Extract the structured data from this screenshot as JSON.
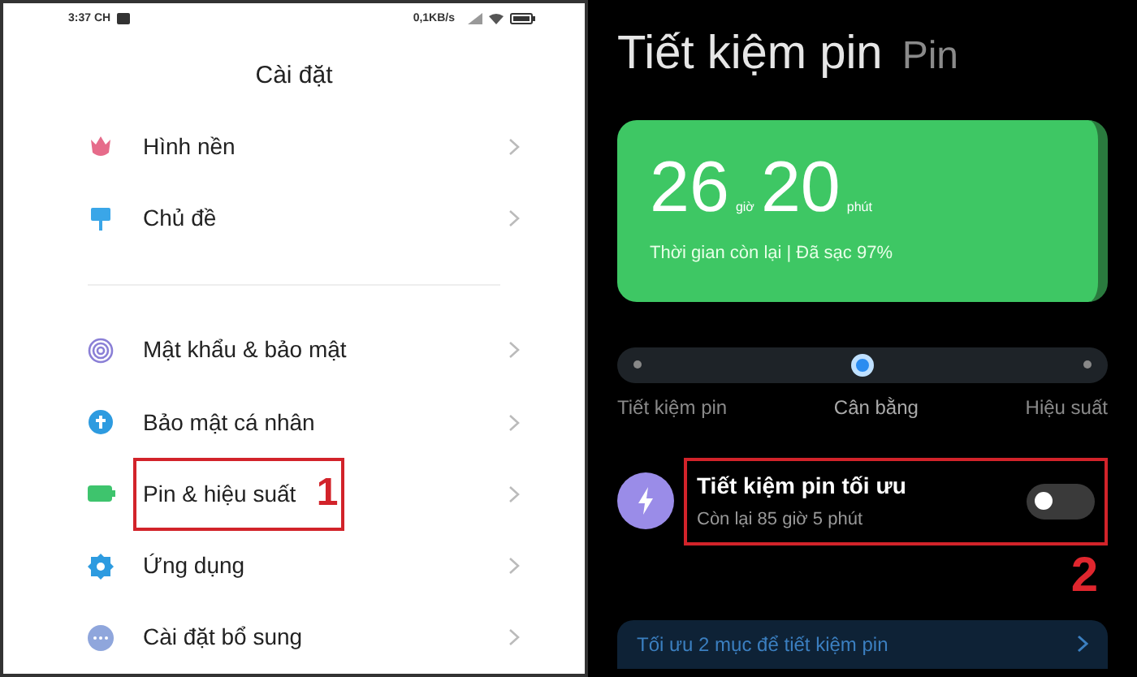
{
  "left_screen": {
    "status_bar": {
      "time": "3:37 CH",
      "network_speed": "0,1KB/s"
    },
    "title": "Cài đặt",
    "groups": [
      {
        "items": [
          {
            "label": "Hình nền",
            "highlighted": false
          },
          {
            "label": "Chủ đề",
            "highlighted": false
          }
        ]
      },
      {
        "items": [
          {
            "label": "Mật khẩu & bảo mật",
            "highlighted": false
          },
          {
            "label": "Bảo mật cá nhân",
            "highlighted": false
          },
          {
            "label": "Pin & hiệu suất",
            "highlighted": true,
            "annotation": "1"
          },
          {
            "label": "Ứng dụng",
            "highlighted": false
          },
          {
            "label": "Cài đặt bổ sung",
            "highlighted": false
          }
        ]
      }
    ]
  },
  "right_screen": {
    "tabs": [
      {
        "label": "Tiết kiệm pin",
        "selected": true
      },
      {
        "label": "Pin",
        "selected": false
      }
    ],
    "battery_card": {
      "hours": "26",
      "hours_unit": "giờ",
      "minutes": "20",
      "minutes_unit": "phút",
      "caption": "Thời gian còn lại | Đã sạc 97%"
    },
    "modes": [
      {
        "label": "Tiết kiệm pin",
        "selected": false
      },
      {
        "label": "Cân bằng",
        "selected": true
      },
      {
        "label": "Hiệu suất",
        "selected": false
      }
    ],
    "optimal_saver": {
      "title": "Tiết kiệm pin tối ưu",
      "subtitle": "Còn lại 85 giờ 5 phút",
      "on": false,
      "highlighted": true,
      "annotation": "2"
    },
    "suggestion": {
      "label": "Tối ưu 2 mục để tiết kiệm pin"
    }
  }
}
